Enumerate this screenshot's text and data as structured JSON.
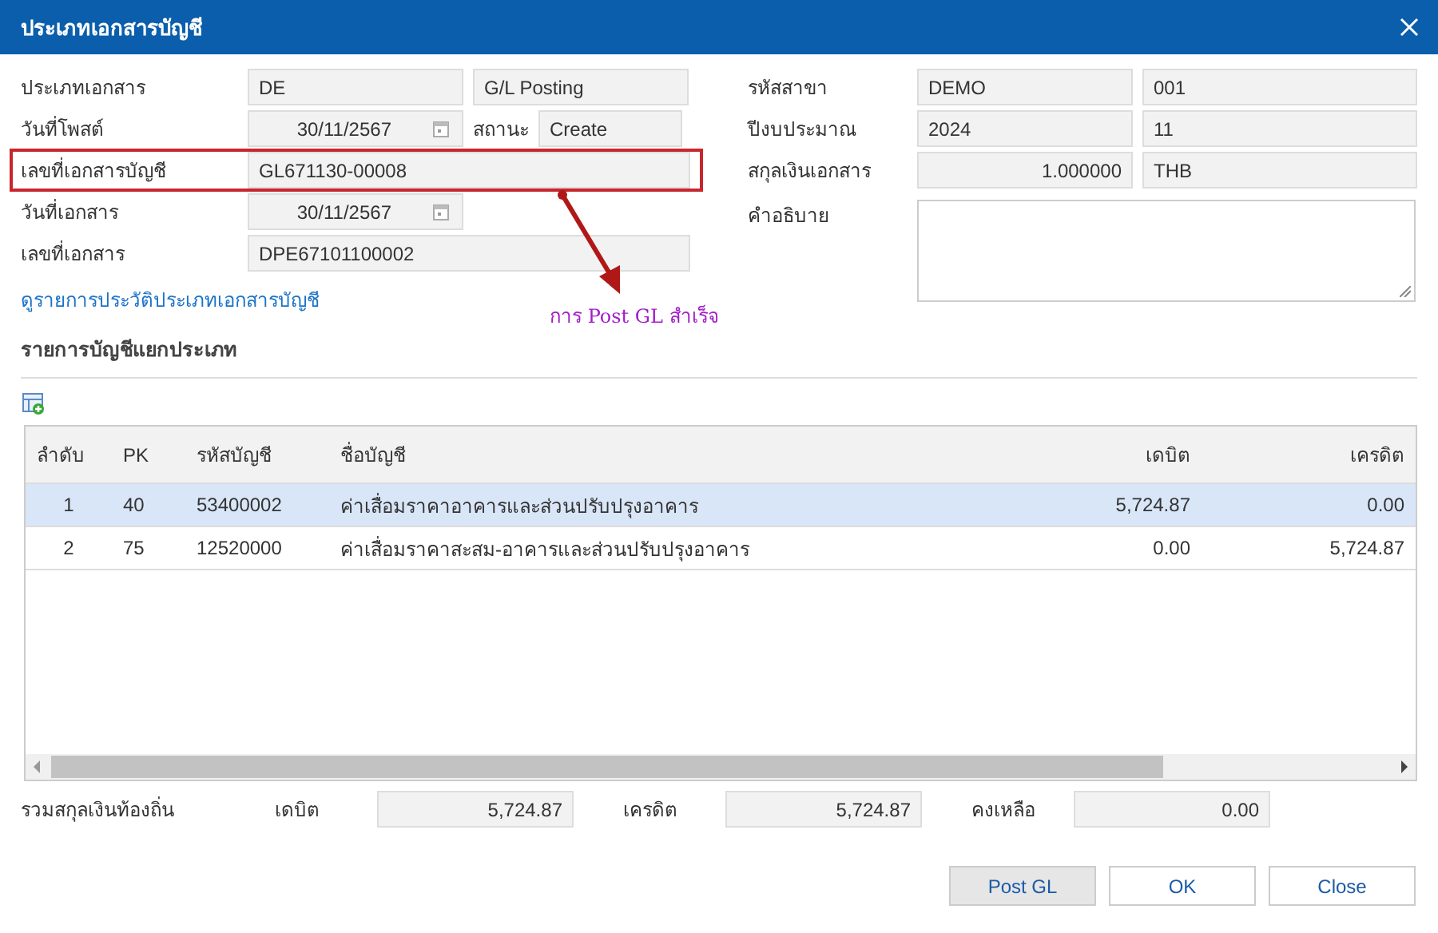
{
  "window": {
    "title": "ประเภทเอกสารบัญชี"
  },
  "left_fields": [
    {
      "label": "ประเภทเอกสาร",
      "kind": "pair",
      "values": [
        "DE",
        "G/L Posting"
      ],
      "highlighted": false
    },
    {
      "label": "วันที่โพสต์",
      "kind": "date_status",
      "value": "30/11/2567",
      "status_label": "สถานะ",
      "status": "Create",
      "highlighted": false
    },
    {
      "label": "เลขที่เอกสารบัญชี",
      "kind": "wide",
      "value": "GL671130-00008",
      "highlighted": true
    },
    {
      "label": "วันที่เอกสาร",
      "kind": "date",
      "value": "30/11/2567",
      "highlighted": false
    },
    {
      "label": "เลขที่เอกสาร",
      "kind": "wide",
      "value": "DPE67101100002",
      "highlighted": false
    }
  ],
  "right_fields": [
    {
      "label": "รหัสสาขา",
      "kind": "pair",
      "values": [
        "DEMO",
        "001"
      ]
    },
    {
      "label": "ปีงบประมาณ",
      "kind": "pair",
      "values": [
        "2024",
        "11"
      ]
    },
    {
      "label": "สกุลเงินเอกสาร",
      "kind": "number_pair",
      "values": [
        "1.000000",
        "THB"
      ]
    },
    {
      "label": "คำอธิบาย",
      "kind": "textarea"
    }
  ],
  "history_link": "ดูรายการประวัติประเภทเอกสารบัญชี",
  "annotation": {
    "text": "การ Post GL สำเร็จ"
  },
  "section_title": "รายการบัญชีแยกประเภท",
  "table": {
    "columns": [
      "ลำดับ",
      "PK",
      "รหัสบัญชี",
      "ชื่อบัญชี",
      "เดบิต",
      "เครดิต"
    ],
    "rows": [
      {
        "cells": [
          "1",
          "40",
          "53400002",
          "ค่าเสื่อมราคาอาคารและส่วนปรับปรุงอาคาร",
          "5,724.87",
          "0.00"
        ],
        "selected": true
      },
      {
        "cells": [
          "2",
          "75",
          "12520000",
          "ค่าเสื่อมราคาสะสม-อาคารและส่วนปรับปรุงอาคาร",
          "0.00",
          "5,724.87"
        ],
        "selected": false
      }
    ]
  },
  "totals": {
    "label": "รวมสกุลเงินท้องถิ่น",
    "items": [
      {
        "label": "เดบิต",
        "value": "5,724.87"
      },
      {
        "label": "เครดิต",
        "value": "5,724.87"
      },
      {
        "label": "คงเหลือ",
        "value": "0.00"
      }
    ]
  },
  "buttons": [
    {
      "label": "Post GL",
      "kind": "grey"
    },
    {
      "label": "OK",
      "kind": "plain"
    },
    {
      "label": "Close",
      "kind": "plain"
    }
  ]
}
